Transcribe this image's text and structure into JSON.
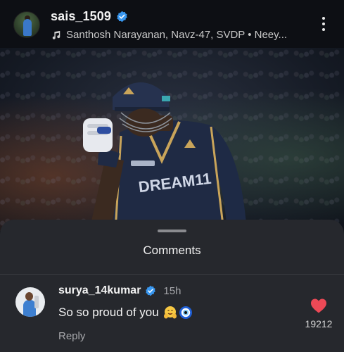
{
  "post": {
    "username": "sais_1509",
    "music": "Santhosh Narayanan, Navz-47, SVDP • Neey..."
  },
  "photo": {
    "jersey_text": "DREAM11"
  },
  "comments_sheet": {
    "title": "Comments",
    "comment": {
      "username": "surya_14kumar",
      "time": "15h",
      "text": "So so proud of you",
      "reply_label": "Reply",
      "likes": "19212"
    }
  },
  "colors": {
    "verified": "#3897f0",
    "heart": "#ed4956",
    "sheet_bg": "#26282d",
    "header_bg": "#0d0f14",
    "jersey": "#1f2a44"
  },
  "icons": [
    "verified-badge-icon",
    "music-note-icon",
    "more-options-icon",
    "hugging-face-emoji",
    "nazar-amulet-emoji",
    "heart-icon"
  ]
}
